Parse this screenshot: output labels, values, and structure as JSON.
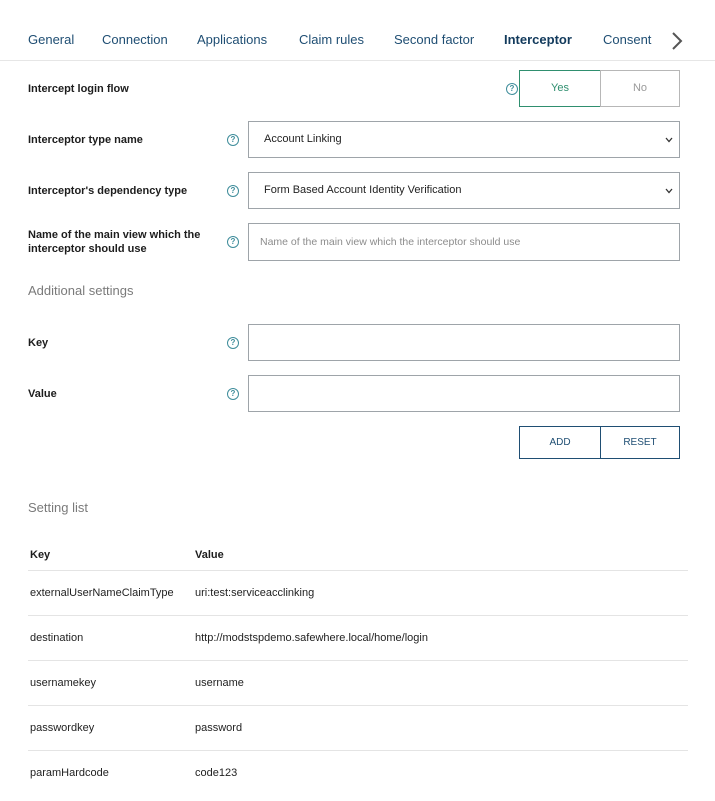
{
  "tabs": [
    {
      "label": "General"
    },
    {
      "label": "Connection"
    },
    {
      "label": "Applications"
    },
    {
      "label": "Claim rules"
    },
    {
      "label": "Second factor"
    },
    {
      "label": "Interceptor"
    },
    {
      "label": "Consent"
    }
  ],
  "active_tab": "Interceptor",
  "intercept_login_flow": {
    "label": "Intercept login flow",
    "yes_label": "Yes",
    "no_label": "No",
    "selected": "Yes"
  },
  "interceptor_type": {
    "label": "Interceptor type name",
    "value": "Account Linking"
  },
  "dependency_type": {
    "label": "Interceptor's dependency type",
    "value": "Form Based Account Identity Verification"
  },
  "main_view": {
    "label_line1": "Name of the main view which the",
    "label_line2": "interceptor should use",
    "placeholder": "Name of the main view which the interceptor should use",
    "value": ""
  },
  "additional_settings": {
    "title": "Additional settings",
    "key_label": "Key",
    "value_label": "Value",
    "key_value": "",
    "value_value": "",
    "add_label": "ADD",
    "reset_label": "RESET"
  },
  "setting_list": {
    "title": "Setting list",
    "columns": [
      "Key",
      "Value"
    ],
    "rows": [
      {
        "key": "externalUserNameClaimType",
        "value": "uri:test:serviceacclinking"
      },
      {
        "key": "destination",
        "value": "http://modstspdemo.safewhere.local/home/login"
      },
      {
        "key": "usernamekey",
        "value": "username"
      },
      {
        "key": "passwordkey",
        "value": "password"
      },
      {
        "key": "paramHardcode",
        "value": "code123"
      }
    ]
  },
  "colors": {
    "tab_text": "#1f4e73",
    "accent_green": "#2f8f6f",
    "help_icon": "#3f8d9b"
  },
  "icons": {
    "help": "question-circle-icon",
    "dropdown": "chevron-down-icon",
    "next_tab": "chevron-right-icon"
  }
}
